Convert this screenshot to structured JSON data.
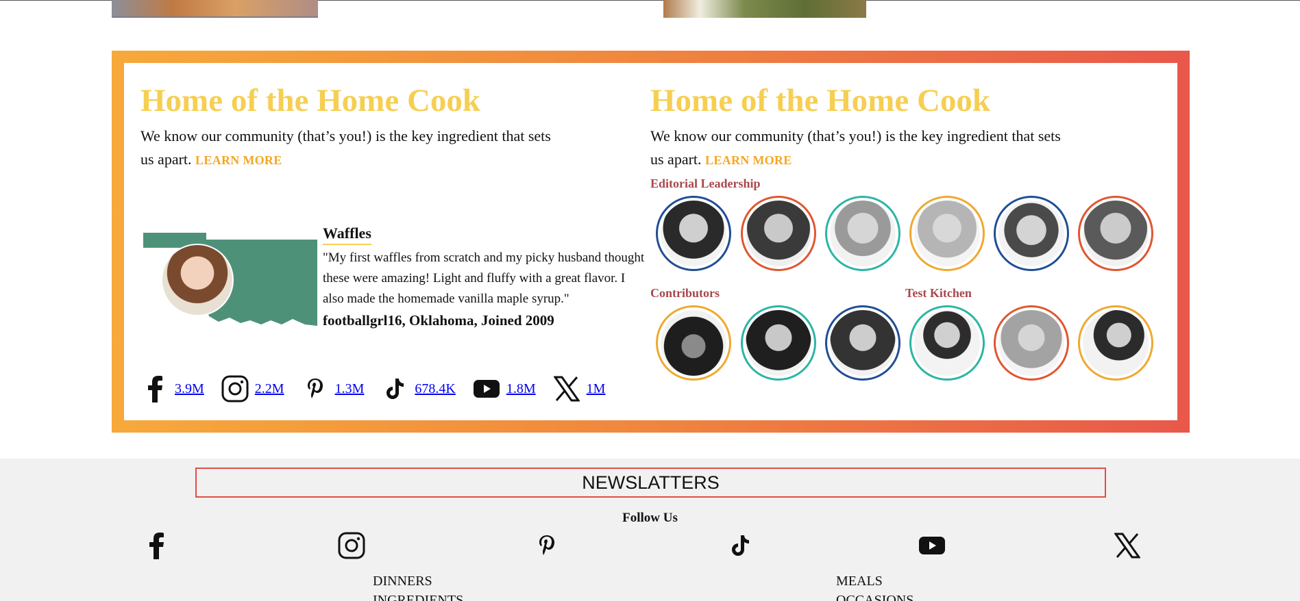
{
  "promo": {
    "title": "Home of the Home Cook",
    "desc": "We know our community (that’s you!) is the key ingredient that sets us apart.",
    "learn_more": "LEARN MORE"
  },
  "review": {
    "recipe": "Waffles",
    "quote": "\"My first waffles from scratch and my picky husband thought these were amazing! Light and fluffy with a great flavor. I also made the homemade vanilla maple syrup.\"",
    "reviewer": "footballgrl16, Oklahoma, Joined 2009"
  },
  "socials": [
    {
      "icon": "facebook-icon",
      "count": "3.9M"
    },
    {
      "icon": "instagram-icon",
      "count": "2.2M"
    },
    {
      "icon": "pinterest-icon",
      "count": "1.3M"
    },
    {
      "icon": "tiktok-icon",
      "count": "678.4K"
    },
    {
      "icon": "youtube-icon",
      "count": "1.8M"
    },
    {
      "icon": "x-icon",
      "count": "1M"
    }
  ],
  "staff": {
    "editorial_label": "Editorial Leadership",
    "contributors_label": "Contributors",
    "test_kitchen_label": "Test Kitchen"
  },
  "footer": {
    "newsletter": "NEWSLATTERS",
    "follow": "Follow Us",
    "links": [
      "DINNERS",
      "INGREDIENTS",
      "MEALS",
      "OCCASIONS"
    ]
  },
  "colors": {
    "title": "#f6cf52",
    "learn_more": "#f5a623",
    "section_label": "#a8474b",
    "frame_start": "#f7a93b",
    "frame_end": "#e9584a",
    "map": "#4e9179"
  }
}
